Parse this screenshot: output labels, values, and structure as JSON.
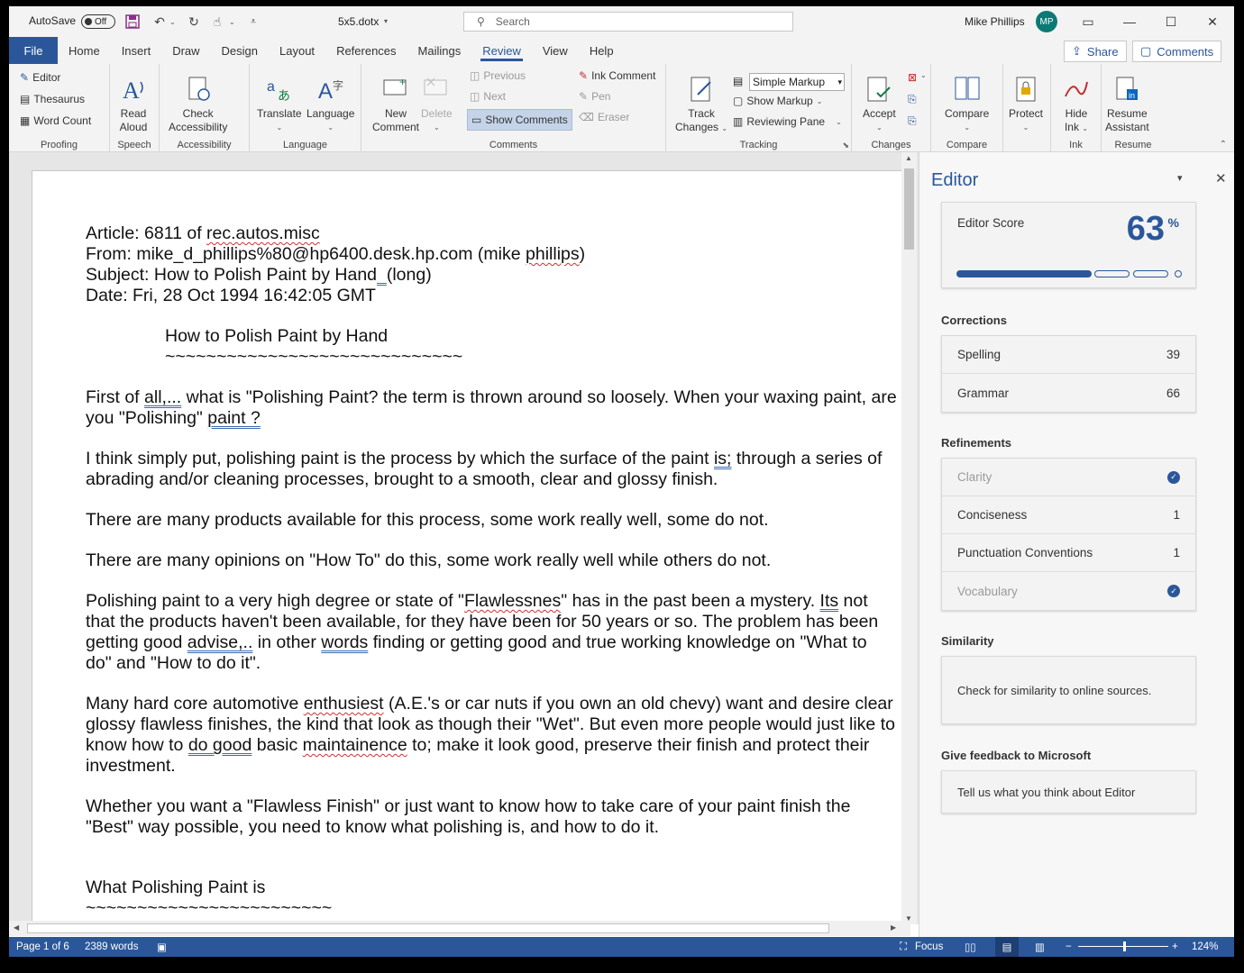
{
  "titlebar": {
    "autosave_label": "AutoSave",
    "autosave_state": "Off",
    "doc_name": "5x5.dotx",
    "search_placeholder": "Search",
    "user_name": "Mike Phillips",
    "user_initials": "MP"
  },
  "tabs": [
    "File",
    "Home",
    "Insert",
    "Draw",
    "Design",
    "Layout",
    "References",
    "Mailings",
    "Review",
    "View",
    "Help"
  ],
  "active_tab": "Review",
  "share_label": "Share",
  "comments_label": "Comments",
  "ribbon": {
    "proofing": {
      "label": "Proofing",
      "editor": "Editor",
      "thesaurus": "Thesaurus",
      "word_count": "Word Count"
    },
    "speech": {
      "label": "Speech",
      "read_aloud_1": "Read",
      "read_aloud_2": "Aloud"
    },
    "accessibility": {
      "label": "Accessibility",
      "check_1": "Check",
      "check_2": "Accessibility"
    },
    "language": {
      "label": "Language",
      "translate": "Translate",
      "language": "Language"
    },
    "comments": {
      "label": "Comments",
      "new_1": "New",
      "new_2": "Comment",
      "delete": "Delete",
      "previous": "Previous",
      "next": "Next",
      "show_comments": "Show Comments",
      "ink_comment": "Ink Comment",
      "pen": "Pen",
      "eraser": "Eraser"
    },
    "tracking": {
      "label": "Tracking",
      "track_1": "Track",
      "track_2": "Changes",
      "markup_select": "Simple Markup",
      "show_markup": "Show Markup",
      "reviewing_pane": "Reviewing Pane"
    },
    "changes": {
      "label": "Changes",
      "accept": "Accept"
    },
    "compare": {
      "label": "Compare",
      "compare": "Compare"
    },
    "protect": {
      "protect": "Protect"
    },
    "ink": {
      "label": "Ink",
      "hide_1": "Hide",
      "hide_2": "Ink"
    },
    "resume": {
      "label": "Resume",
      "resume_1": "Resume",
      "resume_2": "Assistant"
    }
  },
  "document": {
    "l1_a": "Article: 6811 of ",
    "l1_b": "rec.autos.misc",
    "l2_a": "From: mike_d_phillips%80@hp6400.desk.hp.com (mike ",
    "l2_b": "phillips",
    "l2_c": ")",
    "l3_a": "Subject: How to Polish Paint by Hand",
    "l3_b": "  ",
    "l3_c": "(long)",
    "l4": "Date: Fri, 28 Oct 1994 16:42:05 GMT",
    "heading1": "How to Polish Paint by Hand",
    "tilde1": "~~~~~~~~~~~~~~~~~~~~~~~~~~~~~",
    "p1_a": "First of ",
    "p1_b": "all,...",
    "p1_c": " what is \"Polishing Paint?  the term is thrown around so loosely.  When your waxing paint, are you \"Polishing\" ",
    "p1_d": "paint ?",
    "p2_a": "I think simply put, polishing paint is the process by which the surface of the paint ",
    "p2_b": "is;",
    "p2_c": " through a series of abrading and/or cleaning processes, brought to a smooth, clear and glossy finish.",
    "p3": "There are many products available for this process, some work really well, some do not.",
    "p4": "There are many opinions on \"How To\" do this, some work really well while others do not.",
    "p5_a": "Polishing paint to a very high degree or state of \"",
    "p5_b": "Flawlessnes",
    "p5_c": "\" has in the past been a mystery.  ",
    "p5_d": "Its",
    "p5_e": " not that the products haven't been available, for they have been for 50 years or so.  The problem has been getting good ",
    "p5_f": "advise,..",
    "p5_g": " in other ",
    "p5_h": "words",
    "p5_i": " finding or getting good and true working knowledge on \"What to do\" and \"How to do it\".",
    "p6_a": "Many hard core automotive ",
    "p6_b": "enthusiest",
    "p6_c": " (A.E.'s or car nuts if you own an old chevy) want and desire clear glossy flawless finishes, the kind that look as though their \"Wet\".  But even more people would just like to know how to ",
    "p6_d": "do  good",
    "p6_e": " basic ",
    "p6_f": "maintainence",
    "p6_g": " to; make it look good, preserve their finish and protect their investment.",
    "p7": "Whether you want a \"Flawless Finish\" or just want to know how to take care of your paint finish the \"Best\" way possible, you need to know what polishing is, and how to do it.",
    "heading2": "What Polishing Paint is",
    "tilde2": "~~~~~~~~~~~~~~~~~~~~~~~~"
  },
  "editor_pane": {
    "title": "Editor",
    "score_label": "Editor Score",
    "score_value": "63",
    "score_unit": "%",
    "score_fraction": 0.63,
    "corrections_title": "Corrections",
    "spelling_label": "Spelling",
    "spelling_count": "39",
    "grammar_label": "Grammar",
    "grammar_count": "66",
    "refinements_title": "Refinements",
    "clarity": "Clarity",
    "conciseness": "Conciseness",
    "conciseness_count": "1",
    "punctuation": "Punctuation Conventions",
    "punctuation_count": "1",
    "vocabulary": "Vocabulary",
    "similarity_title": "Similarity",
    "similarity_text": "Check for similarity to online sources.",
    "feedback_title": "Give feedback to Microsoft",
    "feedback_text": "Tell us what you think about Editor"
  },
  "status": {
    "page": "Page 1 of 6",
    "words": "2389 words",
    "focus": "Focus",
    "zoom": "124%"
  },
  "colors": {
    "accent": "#2b579a",
    "spelling": "#d03030",
    "avatar": "#0b7a75"
  }
}
